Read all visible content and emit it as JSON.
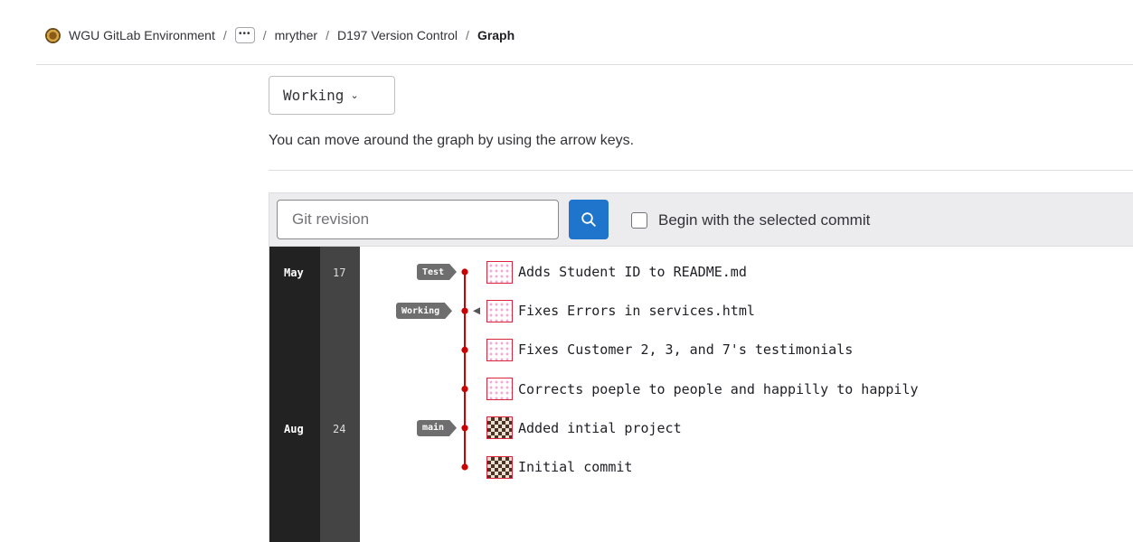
{
  "breadcrumb": {
    "root": "WGU GitLab Environment",
    "ellipsis": "•••",
    "separator": "/",
    "user": "mryther",
    "project": "D197 Version Control",
    "current": "Graph"
  },
  "ref_selector": {
    "selected": "Working",
    "chevron_icon": "chevron-down-icon"
  },
  "help_text": "You can move around the graph by using the arrow keys.",
  "toolbar": {
    "revision_placeholder": "Git revision",
    "search_icon": "search-icon",
    "begin_with_selected_label": "Begin with the selected commit",
    "begin_with_selected_checked": false
  },
  "graph": {
    "months": [
      {
        "label": "May"
      },
      {
        "label": "Aug"
      }
    ],
    "days": [
      {
        "label": "17"
      },
      {
        "label": "24"
      }
    ],
    "line_color": "#cc0000",
    "commits": [
      {
        "message": "Adds Student ID to README.md",
        "avatar": "pink",
        "ref": "Test"
      },
      {
        "message": "Fixes Errors in services.html",
        "avatar": "pink",
        "ref": "Working"
      },
      {
        "message": "Fixes Customer 2, 3, and 7's testimonials",
        "avatar": "pink",
        "ref": ""
      },
      {
        "message": "Corrects poeple to people and happilly to happily",
        "avatar": "pink",
        "ref": ""
      },
      {
        "message": "Added intial project",
        "avatar": "brown",
        "ref": "main"
      },
      {
        "message": "Initial commit",
        "avatar": "brown",
        "ref": ""
      }
    ]
  }
}
